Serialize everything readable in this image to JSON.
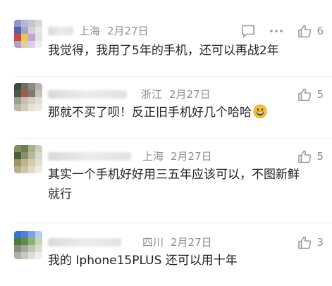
{
  "comments": [
    {
      "location": "上海",
      "date": "2月27日",
      "text": "我觉得，我用了5年的手机，还可以再战2年",
      "likes": "6",
      "has_reply_menu": true,
      "avatar_colors": [
        "#8f98c7",
        "#b3b8d6",
        "#c7c7c7",
        "#d8d8d8",
        "#5662a8",
        "#a0a6c9",
        "#cfd0dc",
        "#e6e6e6",
        "#c44b4b",
        "#e7c84c",
        "#c6a3cf",
        "#e2e2e2",
        "#b2a3c6",
        "#dcd0a5",
        "#d9d2e6",
        "#efefef"
      ]
    },
    {
      "location": "浙江",
      "date": "2月27日",
      "text": "那就不买了呗！反正旧手机好几个哈哈",
      "emoji": "grinning-face",
      "likes": "5",
      "has_reply_menu": false,
      "avatar_colors": [
        "#3f4a3e",
        "#6b6f6a",
        "#8e8a86",
        "#b8b2ab",
        "#4f5a45",
        "#a55a4f",
        "#7f7a72",
        "#c9c2b8",
        "#9aa196",
        "#c8bfb2",
        "#d7d0c4",
        "#e3ddd2",
        "#bdb6aa",
        "#d2cbbf",
        "#e8e2d8",
        "#efebe3"
      ]
    },
    {
      "location": "上海",
      "date": "2月27日",
      "text": "其实一个手机好好用三五年应该可以，不图新鲜就行",
      "likes": "5",
      "has_reply_menu": false,
      "avatar_colors": [
        "#7e8f5a",
        "#6f7e4e",
        "#a7b08a",
        "#c9cdb6",
        "#4d5f3a",
        "#8b8f63",
        "#b7b89a",
        "#d7d8c7",
        "#a09262",
        "#c0b38a",
        "#d5ccae",
        "#e4dfcf",
        "#b6ae8e",
        "#cfc7a9",
        "#e0dbc8",
        "#eeebe1"
      ]
    },
    {
      "location": "四川",
      "date": "2月27日",
      "text": "我的 Iphone15PLUS 还可以用十年",
      "likes": "3",
      "has_reply_menu": false,
      "avatar_colors": [
        "#3a73d1",
        "#4a82dd",
        "#7aa4e6",
        "#b7cdee",
        "#4b7a3c",
        "#5f8c48",
        "#8fb07a",
        "#c5d6b7",
        "#8a8a80",
        "#a7a79c",
        "#c4c4bb",
        "#dcdcd5",
        "#b0b0a8",
        "#cacac3",
        "#dedeD8",
        "#eeeeea"
      ]
    }
  ],
  "icons": {
    "reply": "comment-bubble-icon",
    "more": "more-dots-icon",
    "like": "thumbs-up-icon"
  },
  "colors": {
    "meta_text": "#909090",
    "body_text": "#222222",
    "icon": "#9a9a9a"
  }
}
